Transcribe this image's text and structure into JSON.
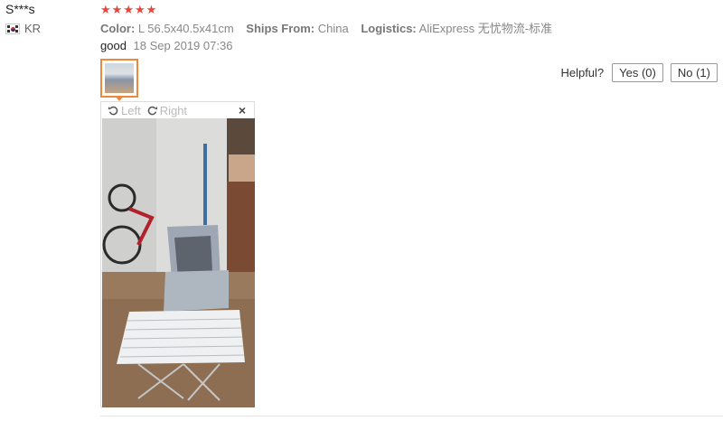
{
  "review": {
    "name": "S***s",
    "country": "KR",
    "rating": 5,
    "attrs": [
      {
        "label": "Color:",
        "value": "L 56.5x40.5x41cm"
      },
      {
        "label": "Ships From:",
        "value": "China"
      },
      {
        "label": "Logistics:",
        "value": "AliExpress 无忧物流-标准"
      }
    ],
    "feedback": "good",
    "date": "18 Sep 2019 07:36",
    "star_color": "#e8453c",
    "thumb_border_color": "#f0883b"
  },
  "helpful": {
    "question": "Helpful?",
    "yes": "Yes (0)",
    "no": "No (1)"
  },
  "viewer": {
    "rotate_left": "Left",
    "rotate_right": "Right",
    "close_symbol": "×",
    "left_icon": "rotate-left-icon",
    "right_icon": "rotate-right-icon"
  }
}
